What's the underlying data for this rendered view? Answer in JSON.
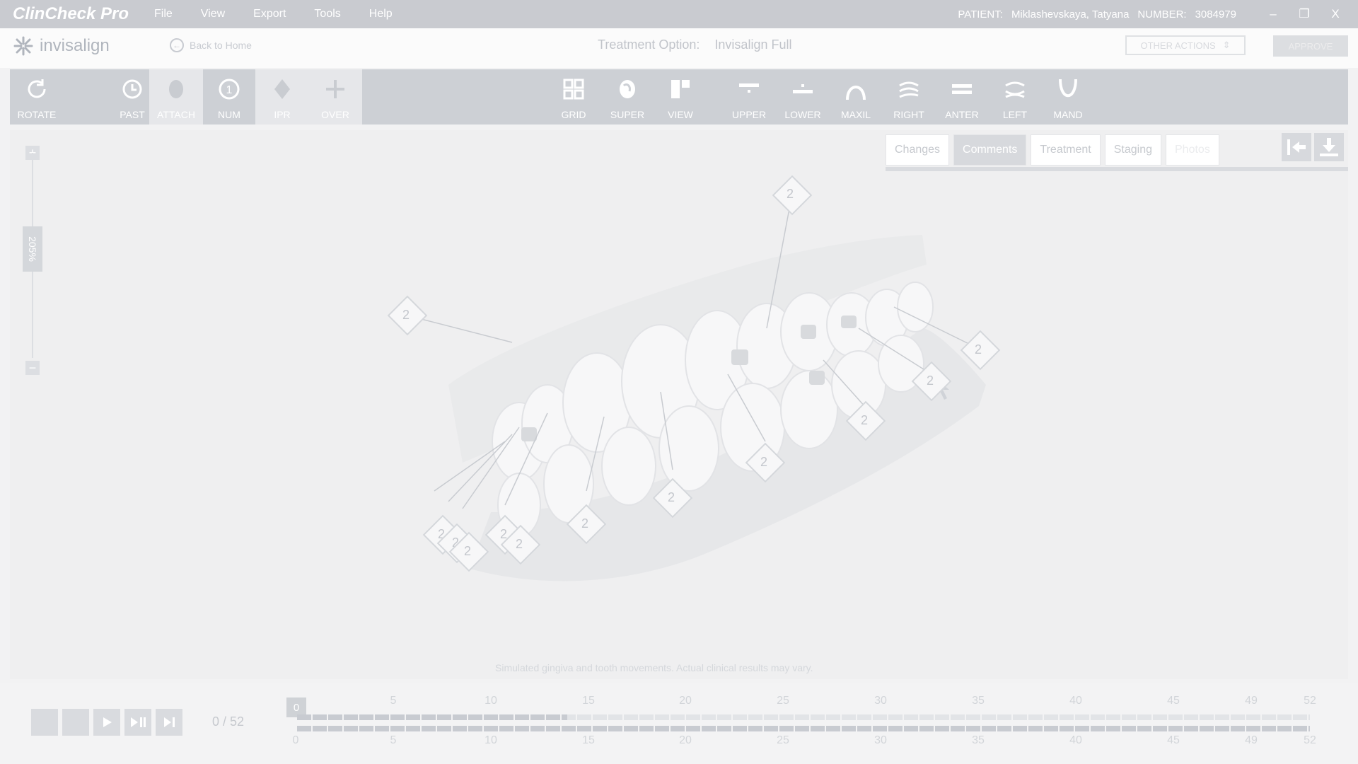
{
  "app": {
    "title": "ClinCheck Pro",
    "menu": [
      "File",
      "View",
      "Export",
      "Tools",
      "Help"
    ],
    "patient_label": "PATIENT:",
    "patient_name": "Miklashevskaya, Tatyana",
    "number_label": "NUMBER:",
    "number_value": "3084979",
    "window_controls": [
      "–",
      "❐",
      "X"
    ]
  },
  "header": {
    "logo_text": "invisalign",
    "back_label": "Back to Home",
    "treatment_label": "Treatment Option:",
    "treatment_value": "Invisalign Full",
    "other_actions": "OTHER ACTIONS",
    "approve": "APPROVE"
  },
  "toolbar": [
    {
      "label": "ROTATE",
      "icon": "rotate-icon",
      "active": false
    },
    {
      "label": "PAST",
      "icon": "past-icon",
      "active": false
    },
    {
      "label": "ATTACH",
      "icon": "attach-icon",
      "active": true
    },
    {
      "label": "NUM",
      "icon": "num-icon",
      "active": false
    },
    {
      "label": "IPR",
      "icon": "ipr-icon",
      "active": true
    },
    {
      "label": "OVER",
      "icon": "over-icon",
      "active": true
    },
    {
      "label": "GRID",
      "icon": "grid-icon",
      "active": false
    },
    {
      "label": "SUPER",
      "icon": "super-icon",
      "active": false
    },
    {
      "label": "VIEW",
      "icon": "view-icon",
      "active": false
    },
    {
      "label": "UPPER",
      "icon": "upper-icon",
      "active": false
    },
    {
      "label": "LOWER",
      "icon": "lower-icon",
      "active": false
    },
    {
      "label": "MAXIL",
      "icon": "maxil-icon",
      "active": false
    },
    {
      "label": "RIGHT",
      "icon": "right-icon",
      "active": false
    },
    {
      "label": "ANTER",
      "icon": "anter-icon",
      "active": false
    },
    {
      "label": "LEFT",
      "icon": "left-icon",
      "active": false
    },
    {
      "label": "MAND",
      "icon": "mand-icon",
      "active": false
    }
  ],
  "zoom": {
    "plus": "+",
    "minus": "−",
    "level": "205%"
  },
  "tabs": [
    {
      "label": "Changes",
      "state": "normal"
    },
    {
      "label": "Comments",
      "state": "active"
    },
    {
      "label": "Treatment",
      "state": "normal"
    },
    {
      "label": "Staging",
      "state": "normal"
    },
    {
      "label": "Photos",
      "state": "disabled"
    }
  ],
  "ipr_labels": [
    "2",
    "2",
    "2",
    "2",
    "2",
    "2",
    "2",
    "2",
    "2",
    "2",
    "2",
    "2",
    "2",
    "2"
  ],
  "disclaimer": "Simulated gingiva and tooth movements. Actual clinical results may vary.",
  "playback": {
    "counter": "0 / 52",
    "current_stage": "0",
    "top_ticks": [
      "5",
      "10",
      "15",
      "20",
      "25",
      "30",
      "35",
      "40",
      "45",
      "49",
      "52"
    ],
    "bottom_ticks": [
      "0",
      "5",
      "10",
      "15",
      "20",
      "25",
      "30",
      "35",
      "40",
      "45",
      "49",
      "52"
    ]
  }
}
